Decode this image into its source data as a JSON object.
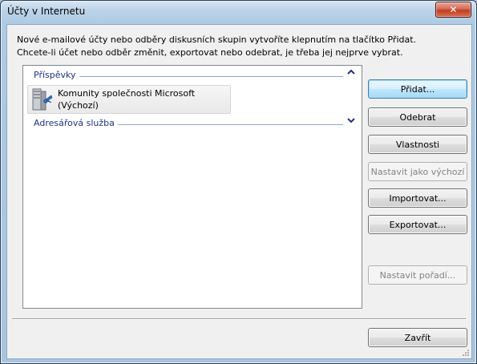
{
  "window": {
    "title": "Účty v Internetu",
    "close_glyph": "✕"
  },
  "info": {
    "line1": "Nové e-mailové účty nebo odběry diskusních skupin vytvoříte klepnutím na tlačítko Přidat.",
    "line2": "Chcete-li účet nebo odběr změnit, exportovat nebo odebrat, je třeba jej nejprve vybrat."
  },
  "list": {
    "groups": [
      {
        "label": "Příspěvky",
        "chevron": "⌃",
        "state": "expanded"
      },
      {
        "label": "Adresářová služba",
        "chevron": "⌄",
        "state": "collapsed"
      }
    ],
    "items": [
      {
        "name": "Komunity společnosti Microsoft",
        "default_tag": "(Výchozí)",
        "icon": "news-server-icon"
      }
    ]
  },
  "buttons": {
    "add": "Přidat...",
    "remove": "Odebrat",
    "properties": "Vlastnosti",
    "set_default": "Nastavit jako výchozí",
    "import": "Importovat...",
    "export": "Exportovat...",
    "set_order": "Nastavit pořadí...",
    "close": "Zavřít"
  },
  "colors": {
    "group_header": "#1e3287",
    "title_bar": "#b5cfe6",
    "close_button": "#c7452a"
  }
}
